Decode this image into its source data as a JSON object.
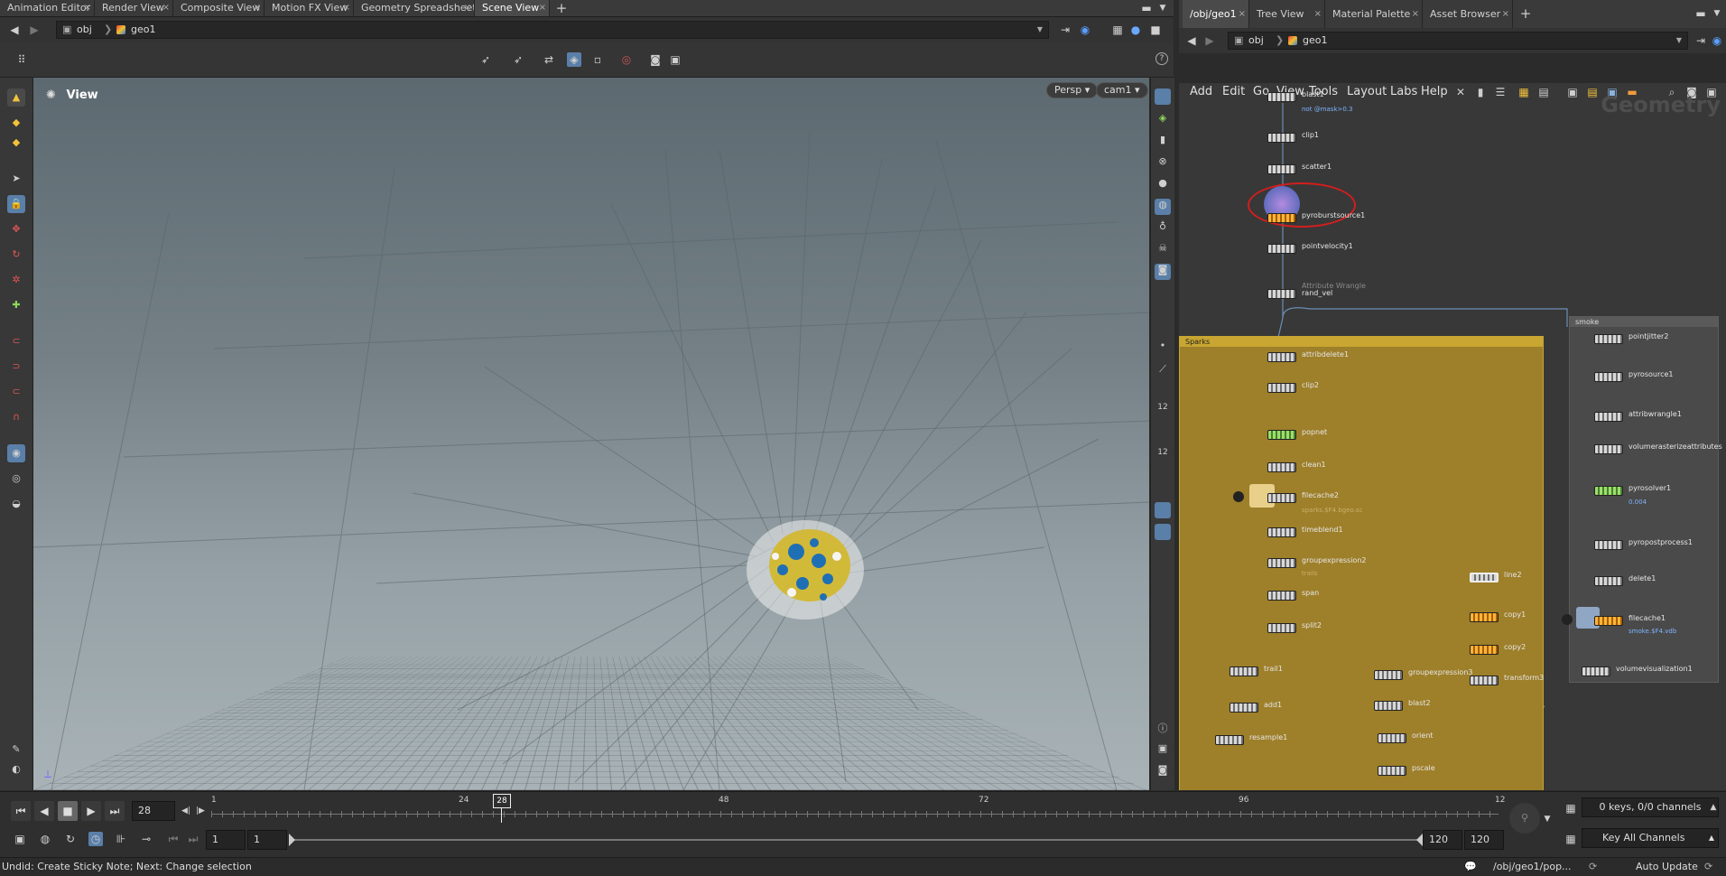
{
  "left_tabs": [
    {
      "label": "Animation Editor"
    },
    {
      "label": "Render View"
    },
    {
      "label": "Composite View"
    },
    {
      "label": "Motion FX View"
    },
    {
      "label": "Geometry Spreadsheet"
    },
    {
      "label": "Scene View"
    }
  ],
  "right_tabs": [
    {
      "label": "/obj/geo1"
    },
    {
      "label": "Tree View"
    },
    {
      "label": "Material Palette"
    },
    {
      "label": "Asset Browser"
    }
  ],
  "left_path": {
    "root": "obj",
    "node": "geo1"
  },
  "right_path": {
    "root": "obj",
    "node": "geo1"
  },
  "viewport": {
    "title": "View",
    "camera_mode": "Persp",
    "camera": "cam1"
  },
  "net_menu": [
    "Add",
    "Edit",
    "Go",
    "View",
    "Tools",
    "Layout",
    "Labs",
    "Help"
  ],
  "net_watermark": "Geometry",
  "nodes": {
    "blast1": "blast1",
    "blast1_sub": "not @mask>0.3",
    "clip1": "clip1",
    "scatter1": "scatter1",
    "pyroburst": "pyroburstsource1",
    "pointvelocity1": "pointvelocity1",
    "rand_vel_type": "Attribute Wrangle",
    "rand_vel": "rand_vel",
    "attribdelete1": "attribdelete1",
    "clip2": "clip2",
    "popnet": "popnet",
    "clean1": "clean1",
    "filecache2": "filecache2",
    "filecache2_sub": "sparks.$F4.bgeo.sc",
    "timeblend1": "timeblend1",
    "groupexpression2": "groupexpression2",
    "groupexpression2_sub": "trails",
    "span": "span",
    "split2": "split2",
    "trail1": "trail1",
    "add1": "add1",
    "resample1": "resample1",
    "groupexpression3": "groupexpression3",
    "blast2": "blast2",
    "orient": "orient",
    "pscale": "pscale",
    "line2": "line2",
    "copy1": "copy1",
    "copy2": "copy2",
    "transform3": "transform3",
    "pointjitter2": "pointjitter2",
    "pyrosource1": "pyrosource1",
    "attribwrangle1": "attribwrangle1",
    "volumerasterize": "volumerasterizeattributes",
    "pyrosolver1": "pyrosolver1",
    "pyrosolver1_sub": "0.004",
    "pyropostprocess1": "pyropostprocess1",
    "delete1": "delete1",
    "filecache1": "filecache1",
    "filecache1_sub": "smoke.$F4.vdb",
    "volumevisualization1": "volumevisualization1"
  },
  "netboxes": {
    "sparks": "Sparks",
    "smoke": "smoke"
  },
  "timeline": {
    "current_frame": "28",
    "ruler_labels": [
      "1",
      "24",
      "48",
      "72",
      "96",
      "12"
    ],
    "range_start": "1",
    "range_start2": "1",
    "range_end": "120",
    "range_end2": "120",
    "keys_info": "0 keys, 0/0 channels",
    "key_all": "Key All Channels"
  },
  "status": {
    "message": "Undid: Create Sticky Note; Next: Change selection",
    "path": "/obj/geo1/pop...",
    "update_mode": "Auto Update"
  },
  "colors": {
    "sparks_box": "#9e7f2a",
    "sparks_header": "#c8a631",
    "selection_ring": "#d21e1e",
    "smoke_box": "#4a4a4a"
  }
}
